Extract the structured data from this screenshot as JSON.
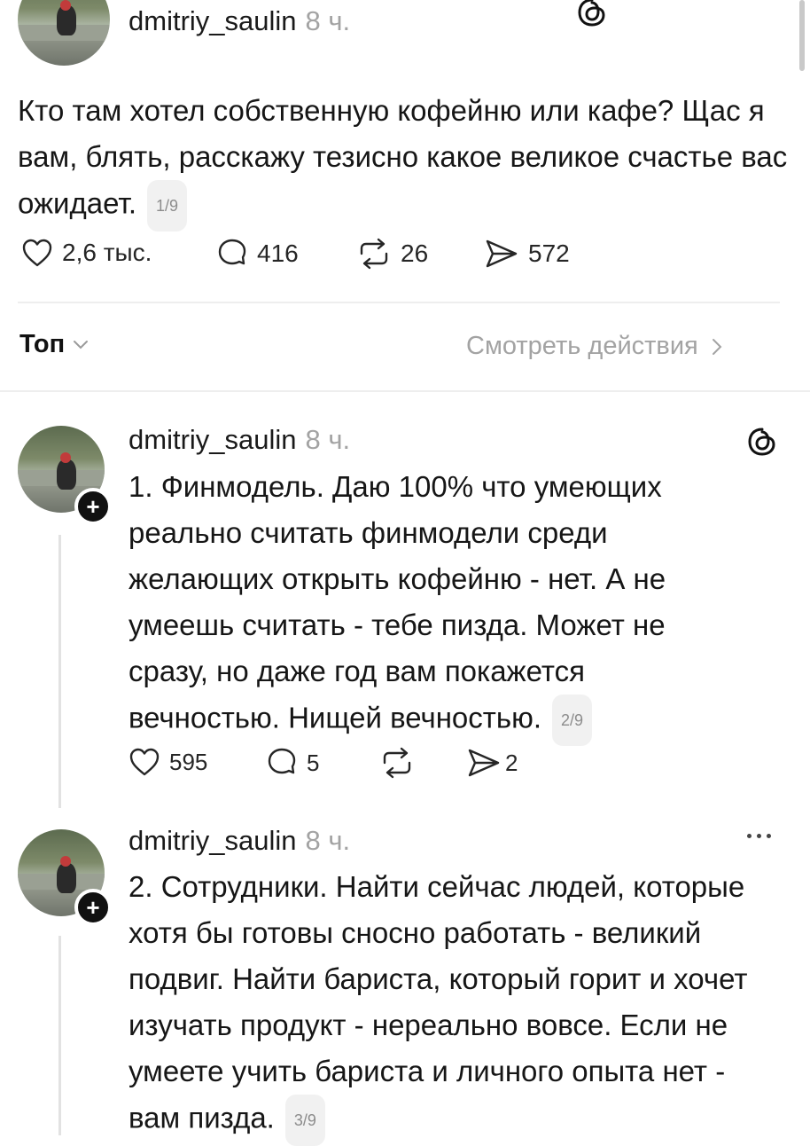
{
  "post": {
    "username": "dmitriy_saulin",
    "time": "8 ч.",
    "text": "Кто там хотел собственную кофейню или кафе? Щас я вам, блять, расскажу тезисно какое великое счастье вас ожидает.",
    "counter": "1/9",
    "likes": "2,6 тыс.",
    "comments": "416",
    "reposts": "26",
    "shares": "572"
  },
  "filter_bar": {
    "sort_label": "Топ",
    "activity_label": "Смотреть действия"
  },
  "replies": [
    {
      "username": "dmitriy_saulin",
      "time": "8 ч.",
      "text": "1. Финмодель. Даю 100% что умеющих реально считать финмодели среди желающих открыть кофейню - нет. А не умеешь считать - тебе пизда. Может не сразу, но даже год вам покажется вечностью. Нищей вечностью.",
      "counter": "2/9",
      "likes": "595",
      "comments": "5",
      "reposts": "",
      "shares": "2"
    },
    {
      "username": "dmitriy_saulin",
      "time": "8 ч.",
      "text": "2. Сотрудники. Найти сейчас людей, которые хотя бы готовы сносно работать - великий подвиг. Найти бариста, который горит и хочет изучать продукт - нереально вовсе. Если не умеете учить бариста и личного опыта нет - вам пизда.",
      "counter": "3/9"
    }
  ],
  "colors": {
    "text": "#161616",
    "muted": "#a3a3a3",
    "divider": "#eeeeee"
  }
}
